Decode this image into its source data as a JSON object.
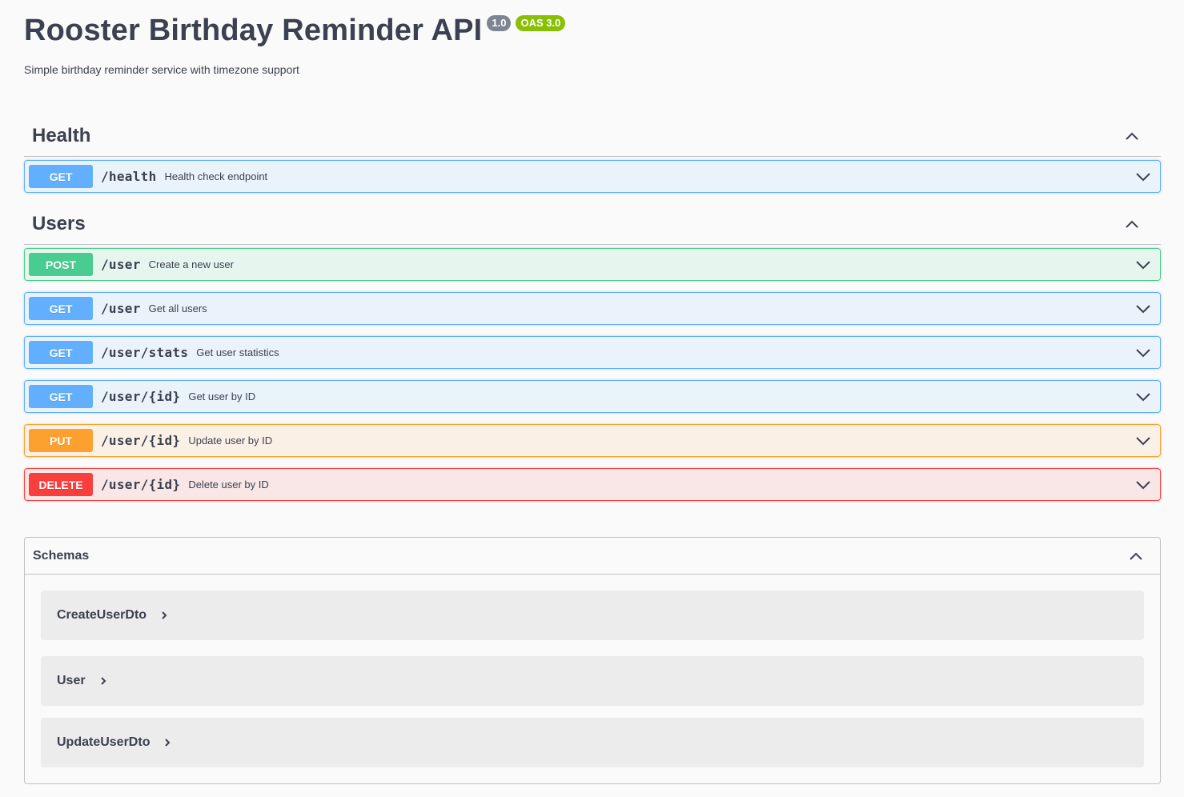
{
  "header": {
    "title": "Rooster Birthday Reminder API",
    "version_badge": "1.0",
    "oas_badge": "OAS 3.0",
    "description": "Simple birthday reminder service with timezone support"
  },
  "tags": [
    {
      "name": "Health",
      "expanded": true,
      "operations": [
        {
          "method": "GET",
          "path": "/health",
          "summary": "Health check endpoint"
        }
      ]
    },
    {
      "name": "Users",
      "expanded": true,
      "operations": [
        {
          "method": "POST",
          "path": "/user",
          "summary": "Create a new user"
        },
        {
          "method": "GET",
          "path": "/user",
          "summary": "Get all users"
        },
        {
          "method": "GET",
          "path": "/user/stats",
          "summary": "Get user statistics"
        },
        {
          "method": "GET",
          "path": "/user/{id}",
          "summary": "Get user by ID"
        },
        {
          "method": "PUT",
          "path": "/user/{id}",
          "summary": "Update user by ID"
        },
        {
          "method": "DELETE",
          "path": "/user/{id}",
          "summary": "Delete user by ID"
        }
      ]
    }
  ],
  "schemas": {
    "title": "Schemas",
    "models": [
      "CreateUserDto",
      "User",
      "UpdateUserDto"
    ]
  },
  "colors": {
    "get": "#61affe",
    "post": "#49cc90",
    "put": "#fca130",
    "delete": "#f93e3e",
    "oas_badge": "#89bf04",
    "version_badge": "#7d8492"
  },
  "icons": {
    "tag_toggle": "chevron-up-icon",
    "operation_toggle": "chevron-down-icon",
    "model_toggle": "chevron-right-icon"
  }
}
